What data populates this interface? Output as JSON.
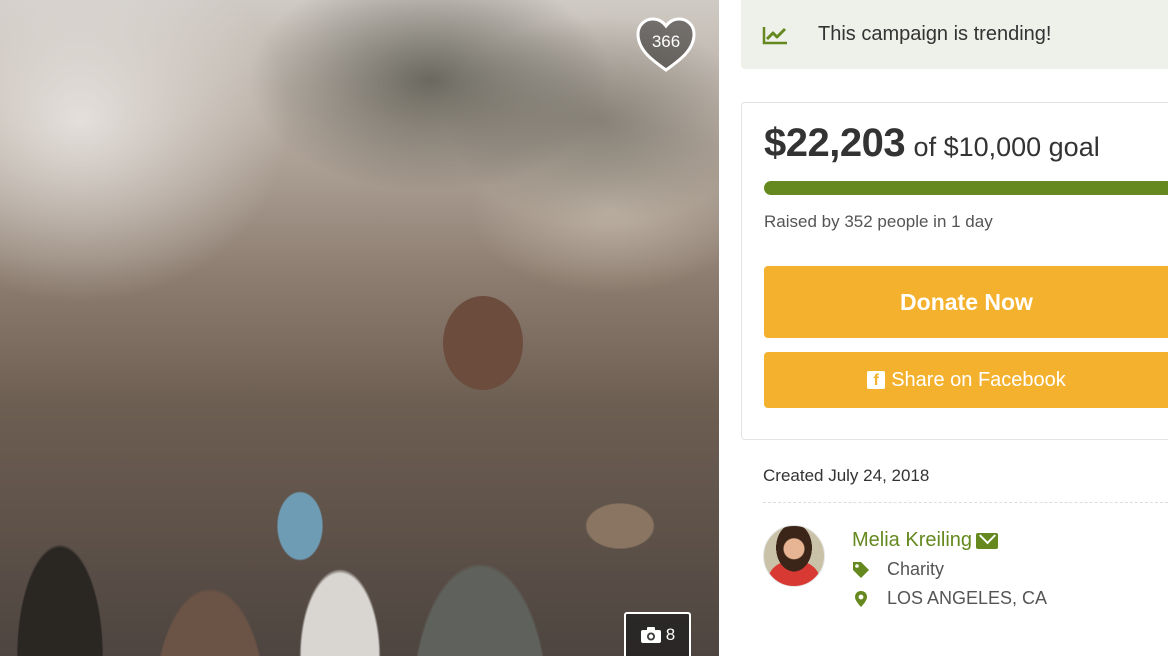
{
  "photo": {
    "like_count": "366",
    "photo_count": "8",
    "icons": {
      "like": "heart-icon",
      "photos": "camera-icon"
    }
  },
  "trending": {
    "icon": "trending-chart-icon",
    "text": "This campaign is trending!"
  },
  "donation": {
    "raised_amount": "$22,203",
    "goal_text": "of $10,000 goal",
    "progress_fraction": 1.0,
    "raised_by_text": "Raised by 352 people in 1 day",
    "donate_label": "Donate Now",
    "share_label": "Share on Facebook"
  },
  "organizer": {
    "created_text": "Created July 24, 2018",
    "name": "Melia Kreiling",
    "category": "Charity",
    "location": "LOS ANGELES, CA"
  },
  "colors": {
    "accent_green": "#65891e",
    "button_orange": "#f4b12e",
    "trending_bg": "#eef0ea"
  }
}
